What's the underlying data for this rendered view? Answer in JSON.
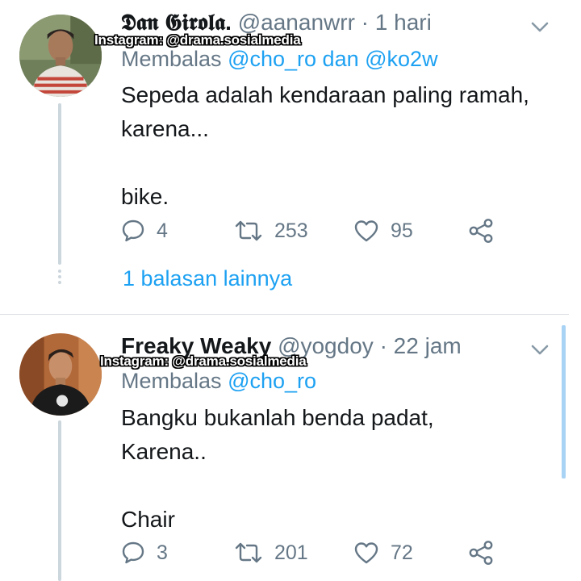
{
  "watermark": "Instagram: @drama.sosialmedia",
  "tweets": [
    {
      "display_name": "𝕯𝖆𝖓 𝕲𝖎𝖗𝖔𝖑𝖆.",
      "handle": "@aananwrr",
      "separator": "·",
      "time": "1 hari",
      "reply_prefix": "Membalas",
      "reply_to_1": "@cho_ro",
      "reply_and": "dan",
      "reply_to_2": "@ko2w",
      "text_lines": [
        "Sepeda adalah kendaraan paling ramah,",
        "karena...",
        "bike."
      ],
      "replies": "4",
      "retweets": "253",
      "likes": "95",
      "more_replies": "1 balasan lainnya"
    },
    {
      "display_name": "Freaky Weaky",
      "handle": "@yogdoy",
      "separator": "·",
      "time": "22 jam",
      "reply_prefix": "Membalas",
      "reply_to_1": "@cho_ro",
      "text_lines": [
        "Bangku bukanlah benda padat,",
        "Karena..",
        "Chair"
      ],
      "replies": "3",
      "retweets": "201",
      "likes": "72"
    }
  ],
  "icons": {
    "reply": "reply-icon",
    "retweet": "retweet-icon",
    "like": "heart-icon",
    "share": "share-icon",
    "menu": "chevron-down-icon"
  },
  "colors": {
    "link": "#1da1f2",
    "secondary_text": "#657786",
    "thread_line": "#ccd6dd"
  }
}
